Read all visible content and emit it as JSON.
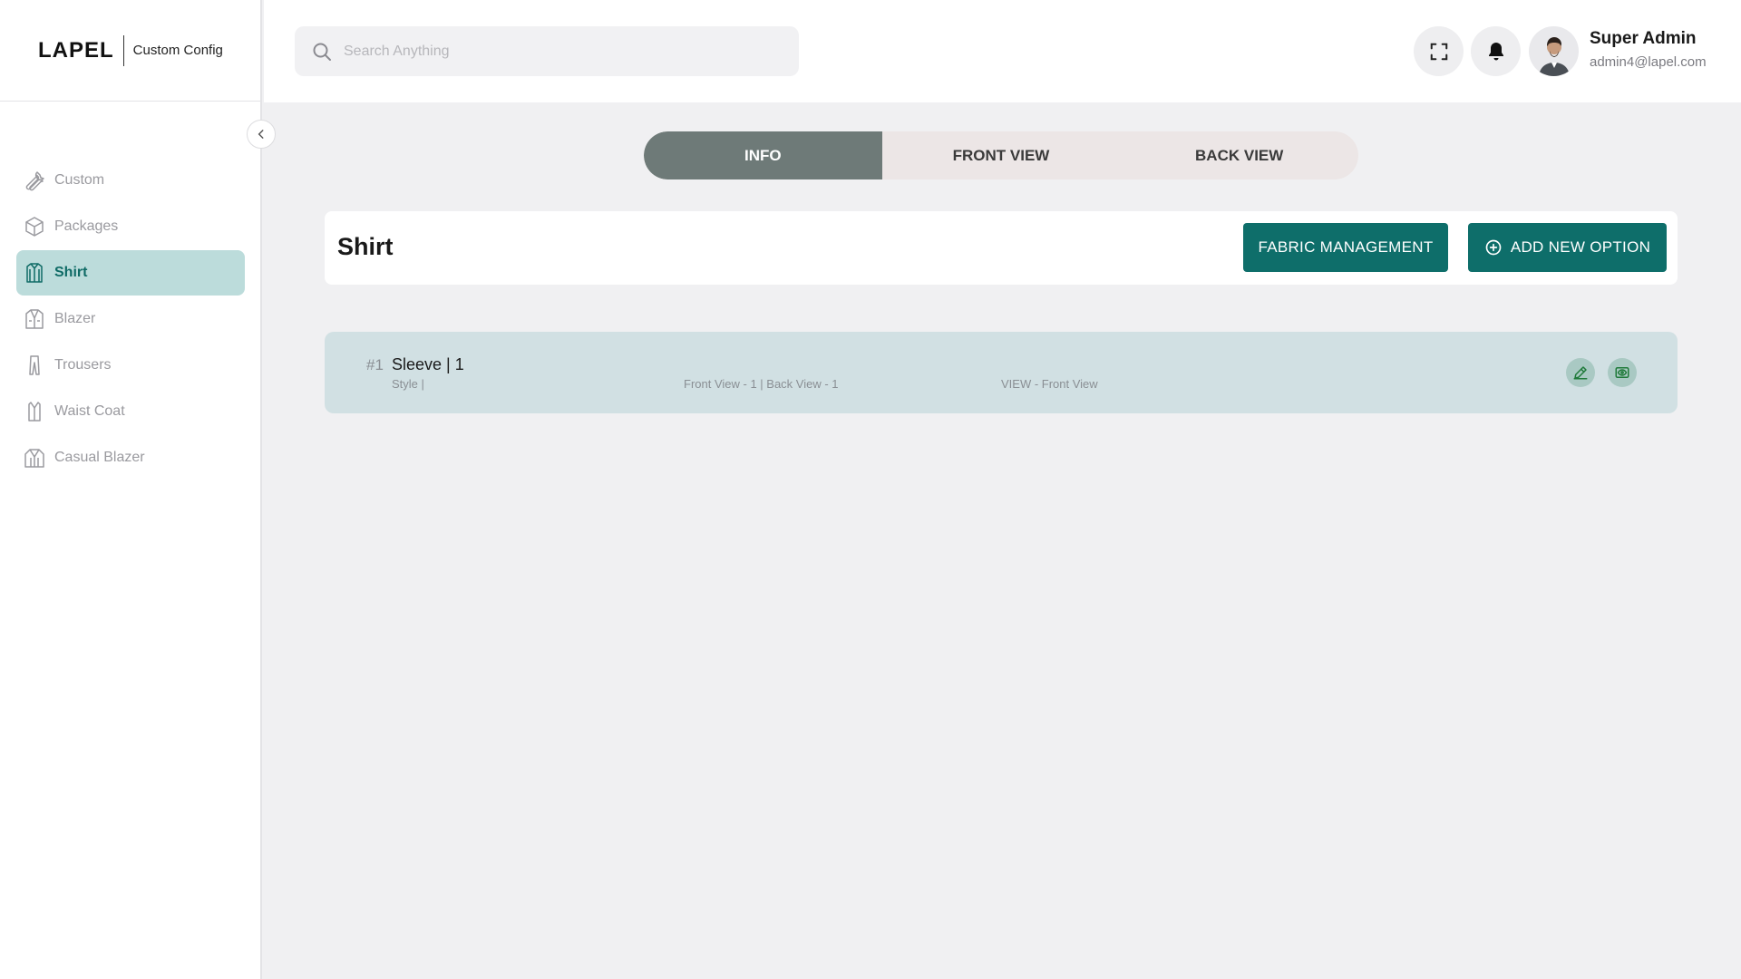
{
  "brand": {
    "logo": "LAPEL",
    "subtitle": "Custom Config"
  },
  "sidebar": {
    "items": [
      {
        "label": "Custom",
        "icon": "wrench-icon",
        "active": false
      },
      {
        "label": "Packages",
        "icon": "box-icon",
        "active": false
      },
      {
        "label": "Shirt",
        "icon": "shirt-icon",
        "active": true
      },
      {
        "label": "Blazer",
        "icon": "blazer-icon",
        "active": false
      },
      {
        "label": "Trousers",
        "icon": "trousers-icon",
        "active": false
      },
      {
        "label": "Waist Coat",
        "icon": "waistcoat-icon",
        "active": false
      },
      {
        "label": "Casual Blazer",
        "icon": "casual-blazer-icon",
        "active": false
      }
    ]
  },
  "header": {
    "search_placeholder": "Search Anything",
    "user": {
      "name": "Super Admin",
      "email": "admin4@lapel.com"
    }
  },
  "tabs": [
    {
      "label": "INFO",
      "active": true
    },
    {
      "label": "FRONT VIEW",
      "active": false
    },
    {
      "label": "BACK VIEW",
      "active": false
    }
  ],
  "main": {
    "title": "Shirt",
    "fabric_button": "FABRIC MANAGEMENT",
    "add_button": "ADD NEW OPTION",
    "options": [
      {
        "index": "#1",
        "title": "Sleeve | 1",
        "style": "Style |",
        "views": "Front View - 1 | Back View - 1",
        "view_label": "VIEW - Front View"
      }
    ]
  },
  "colors": {
    "accent": "#0e6e6a",
    "active_nav_bg": "#bcdcdb",
    "tab_active": "#6e7a78",
    "row_bg": "#d1e0e3"
  }
}
